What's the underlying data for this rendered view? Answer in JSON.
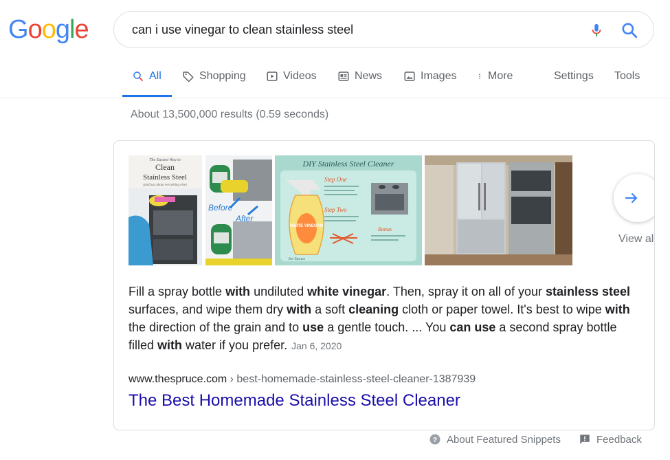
{
  "logo": {
    "text": "Google"
  },
  "search": {
    "query": "can i use vinegar to clean stainless steel"
  },
  "tabs": [
    {
      "label": "All",
      "icon": "search-icon"
    },
    {
      "label": "Shopping",
      "icon": "tag-icon"
    },
    {
      "label": "Videos",
      "icon": "play-icon"
    },
    {
      "label": "News",
      "icon": "news-icon"
    },
    {
      "label": "Images",
      "icon": "image-icon"
    },
    {
      "label": "More",
      "icon": "more-vert-icon"
    },
    {
      "label": "Settings"
    },
    {
      "label": "Tools"
    }
  ],
  "results_stats": "About 13,500,000 results (0.59 seconds)",
  "featured_snippet": {
    "images": [
      {
        "caption_lines": [
          "The Easiest Way to",
          "Clean",
          "Stainless Steel",
          "(and just about everything else)"
        ]
      },
      {
        "caption_lines": [
          "Before",
          "After"
        ]
      },
      {
        "caption_lines": [
          "DIY Stainless Steel Cleaner",
          "Step One",
          "Step Two",
          "Bonus",
          "WHITE VINEGAR",
          "the Spruce"
        ]
      },
      {
        "caption_lines": []
      }
    ],
    "view_all": "View all",
    "text_parts": [
      {
        "t": "Fill a spray bottle ",
        "b": false
      },
      {
        "t": "with",
        "b": true
      },
      {
        "t": " undiluted ",
        "b": false
      },
      {
        "t": "white vinegar",
        "b": true
      },
      {
        "t": ". Then, spray it on all of your ",
        "b": false
      },
      {
        "t": "stainless steel",
        "b": true
      },
      {
        "t": " surfaces, and wipe them dry ",
        "b": false
      },
      {
        "t": "with",
        "b": true
      },
      {
        "t": " a soft ",
        "b": false
      },
      {
        "t": "cleaning",
        "b": true
      },
      {
        "t": " cloth or paper towel. It's best to wipe ",
        "b": false
      },
      {
        "t": "with",
        "b": true
      },
      {
        "t": " the direction of the grain and to ",
        "b": false
      },
      {
        "t": "use",
        "b": true
      },
      {
        "t": " a gentle touch. ... You ",
        "b": false
      },
      {
        "t": "can use",
        "b": true
      },
      {
        "t": " a second spray bottle filled ",
        "b": false
      },
      {
        "t": "with",
        "b": true
      },
      {
        "t": " water if you prefer.",
        "b": false
      }
    ],
    "date": "Jan 6, 2020",
    "cite_domain": "www.thespruce.com",
    "cite_path": " › best-homemade-stainless-steel-cleaner-1387939",
    "title": "The Best Homemade Stainless Steel Cleaner"
  },
  "footer": {
    "about": "About Featured Snippets",
    "feedback": "Feedback"
  },
  "colors": {
    "link": "#1a0dab",
    "accent": "#1a73e8",
    "muted": "#70757a",
    "logo_blue": "#4285f4",
    "logo_red": "#ea4335",
    "logo_yellow": "#fbbc05",
    "logo_green": "#34a853"
  }
}
